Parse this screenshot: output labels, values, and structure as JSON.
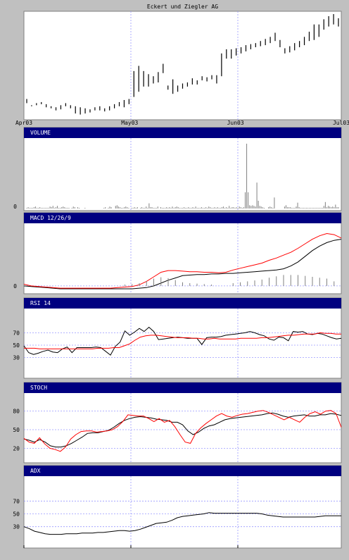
{
  "colors": {
    "background": "#c0c0c0",
    "panel": "#ffffff",
    "header": "#000080",
    "header_text": "#ffffff",
    "grid": "#9999ff",
    "line_black": "#000000",
    "line_red": "#ff0000",
    "volume_bar": "#808080"
  },
  "chart_data": [
    {
      "type": "bar",
      "subtype": "ohlc",
      "title": "Eckert und Ziegler AG",
      "x_tick_labels": [
        "Apr03",
        "May03",
        "Jun03",
        "Jul03"
      ],
      "x_tick_index": [
        0,
        21,
        42,
        63
      ],
      "ylim": [
        0,
        100
      ],
      "grid": "vertical dashed",
      "series": [
        {
          "values": [
            {
              "h": 18,
              "l": 14
            },
            {
              "h": 12,
              "l": 11
            },
            {
              "h": 14,
              "l": 12
            },
            {
              "h": 15,
              "l": 13
            },
            {
              "h": 13,
              "l": 10
            },
            {
              "h": 11,
              "l": 9
            },
            {
              "h": 10,
              "l": 7
            },
            {
              "h": 12,
              "l": 8
            },
            {
              "h": 14,
              "l": 11
            },
            {
              "h": 12,
              "l": 9
            },
            {
              "h": 11,
              "l": 4
            },
            {
              "h": 10,
              "l": 3
            },
            {
              "h": 9,
              "l": 4
            },
            {
              "h": 8,
              "l": 5
            },
            {
              "h": 10,
              "l": 7
            },
            {
              "h": 11,
              "l": 7
            },
            {
              "h": 9,
              "l": 6
            },
            {
              "h": 11,
              "l": 7
            },
            {
              "h": 13,
              "l": 9
            },
            {
              "h": 15,
              "l": 11
            },
            {
              "h": 17,
              "l": 10
            },
            {
              "h": 18,
              "l": 13
            },
            {
              "h": 45,
              "l": 20
            },
            {
              "h": 50,
              "l": 25
            },
            {
              "h": 45,
              "l": 30
            },
            {
              "h": 42,
              "l": 30
            },
            {
              "h": 40,
              "l": 33
            },
            {
              "h": 44,
              "l": 34
            },
            {
              "h": 52,
              "l": 43
            },
            {
              "h": 31,
              "l": 27
            },
            {
              "h": 37,
              "l": 23
            },
            {
              "h": 31,
              "l": 25
            },
            {
              "h": 33,
              "l": 28
            },
            {
              "h": 34,
              "l": 30
            },
            {
              "h": 38,
              "l": 32
            },
            {
              "h": 36,
              "l": 32
            },
            {
              "h": 40,
              "l": 36
            },
            {
              "h": 39,
              "l": 35
            },
            {
              "h": 41,
              "l": 37
            },
            {
              "h": 41,
              "l": 33
            },
            {
              "h": 62,
              "l": 40
            },
            {
              "h": 66,
              "l": 57
            },
            {
              "h": 66,
              "l": 57
            },
            {
              "h": 67,
              "l": 60
            },
            {
              "h": 68,
              "l": 62
            },
            {
              "h": 70,
              "l": 64
            },
            {
              "h": 71,
              "l": 66
            },
            {
              "h": 72,
              "l": 68
            },
            {
              "h": 74,
              "l": 69
            },
            {
              "h": 76,
              "l": 70
            },
            {
              "h": 78,
              "l": 72
            },
            {
              "h": 82,
              "l": 74
            },
            {
              "h": 75,
              "l": 68
            },
            {
              "h": 67,
              "l": 62
            },
            {
              "h": 69,
              "l": 63
            },
            {
              "h": 72,
              "l": 65
            },
            {
              "h": 74,
              "l": 68
            },
            {
              "h": 78,
              "l": 70
            },
            {
              "h": 83,
              "l": 74
            },
            {
              "h": 90,
              "l": 75
            },
            {
              "h": 90,
              "l": 78
            },
            {
              "h": 95,
              "l": 85
            },
            {
              "h": 98,
              "l": 88
            },
            {
              "h": 100,
              "l": 90
            },
            {
              "h": 96,
              "l": 88
            }
          ]
        }
      ]
    },
    {
      "type": "bar",
      "label": "VOLUME",
      "y_tick_labels": [
        "0"
      ],
      "ylim": [
        0,
        100
      ],
      "series": [
        {
          "values": [
            1,
            2,
            1,
            1,
            1,
            2,
            3,
            1,
            1,
            2,
            1,
            1,
            1,
            1,
            1,
            1,
            3,
            2,
            4,
            1,
            2,
            4,
            1,
            1,
            2,
            3,
            2,
            1,
            1,
            1,
            0,
            1,
            3,
            2,
            0,
            2,
            1,
            0,
            0,
            0,
            1,
            0,
            0,
            0,
            0,
            0,
            0,
            0,
            0,
            0,
            0,
            0,
            0,
            1,
            2,
            0,
            1,
            3,
            2,
            0,
            0,
            4,
            5,
            3,
            2,
            1,
            1,
            2,
            3,
            2,
            1,
            0,
            1,
            1,
            2,
            1,
            2,
            0,
            1,
            2,
            1,
            1,
            3,
            1,
            8,
            2,
            2,
            1,
            1,
            1,
            3,
            0,
            2,
            1,
            1,
            1,
            2,
            1,
            2,
            1,
            3,
            1,
            2,
            3,
            2,
            1,
            1,
            1,
            2,
            1,
            1,
            2,
            1,
            1,
            2,
            1,
            3,
            1,
            1,
            1,
            2,
            1,
            1,
            2,
            1,
            3,
            2,
            1,
            1,
            2,
            1,
            2,
            1,
            1,
            2,
            3,
            1,
            2,
            1,
            4,
            1,
            2,
            2,
            1,
            2,
            1,
            3,
            2,
            1,
            2,
            25,
            100,
            25,
            5,
            4,
            5,
            4,
            3,
            40,
            12,
            4,
            3,
            2,
            1,
            0,
            0,
            2,
            3,
            2,
            1,
            17,
            0,
            0,
            0,
            0,
            0,
            0,
            3,
            5,
            2,
            2,
            2,
            1,
            1,
            1,
            3,
            9,
            2,
            1,
            1,
            1,
            1,
            1,
            1,
            1,
            1,
            1,
            1,
            1,
            1,
            1,
            1,
            1,
            1,
            4,
            10,
            2,
            4,
            3,
            2,
            3,
            2,
            6,
            2,
            2
          ]
        }
      ]
    },
    {
      "type": "line",
      "label": "MACD 12/26/9",
      "y_tick_labels": [
        "0"
      ],
      "ylim": [
        -10,
        100
      ],
      "series": [
        {
          "color": "#000000",
          "values": [
            0,
            -1,
            -2,
            -3,
            -4,
            -5,
            -5,
            -5,
            -5,
            -5,
            -5,
            -5,
            -5,
            -5,
            -5,
            -5,
            -4,
            -3,
            0,
            5,
            10,
            14,
            18,
            19,
            20,
            20,
            21,
            21,
            22,
            22,
            23,
            24,
            25,
            26,
            27,
            28,
            30,
            35,
            42,
            52,
            62,
            70,
            76,
            80,
            82
          ]
        },
        {
          "color": "#ff0000",
          "values": [
            3,
            0,
            -1,
            -2,
            -3,
            -4,
            -4,
            -4,
            -4,
            -4,
            -4,
            -4,
            -4,
            -3,
            -2,
            -1,
            2,
            8,
            16,
            24,
            27,
            27,
            26,
            25,
            25,
            24,
            24,
            23,
            24,
            28,
            31,
            34,
            37,
            40,
            45,
            49,
            54,
            59,
            66,
            74,
            82,
            88,
            92,
            90,
            84
          ]
        }
      ]
    },
    {
      "type": "line",
      "label": "RSI 14",
      "y_tick_labels": [
        "70",
        "50",
        "30"
      ],
      "y_ticks": [
        70,
        50,
        30
      ],
      "ylim": [
        0,
        100
      ],
      "series": [
        {
          "color": "#000000",
          "values": [
            49,
            38,
            35,
            37,
            40,
            42,
            39,
            38,
            44,
            47,
            38,
            46,
            46,
            46,
            46,
            47,
            46,
            40,
            34,
            48,
            55,
            73,
            66,
            71,
            77,
            72,
            79,
            72,
            59,
            60,
            61,
            62,
            63,
            62,
            61,
            61,
            61,
            51,
            62,
            63,
            63,
            64,
            66,
            67,
            68,
            69,
            70,
            72,
            70,
            67,
            65,
            60,
            58,
            63,
            62,
            57,
            72,
            71,
            72,
            68,
            67,
            69,
            68,
            65,
            62,
            60,
            61
          ]
        },
        {
          "color": "#ff0000",
          "values": [
            45,
            45,
            45,
            44,
            44,
            44,
            44,
            44,
            44,
            44,
            44,
            44,
            44,
            44,
            45,
            45,
            45,
            46,
            46,
            49,
            52,
            58,
            63,
            65,
            66,
            66,
            65,
            64,
            63,
            62,
            62,
            62,
            61,
            61,
            60,
            60,
            61,
            60,
            60,
            60,
            60,
            61,
            61,
            61,
            61,
            62,
            62,
            63,
            64,
            65,
            66,
            66,
            67,
            68,
            68,
            68,
            70,
            69,
            69,
            68,
            68
          ]
        }
      ]
    },
    {
      "type": "line",
      "label": "STOCH",
      "y_tick_labels": [
        "80",
        "50",
        "20"
      ],
      "y_ticks": [
        80,
        50,
        20
      ],
      "ylim": [
        0,
        100
      ],
      "series": [
        {
          "color": "#000000",
          "values": [
            35,
            33,
            30,
            34,
            30,
            24,
            22,
            22,
            24,
            28,
            33,
            38,
            44,
            45,
            45,
            47,
            49,
            54,
            60,
            65,
            68,
            70,
            71,
            70,
            69,
            67,
            66,
            65,
            62,
            62,
            58,
            48,
            42,
            46,
            52,
            56,
            58,
            62,
            66,
            68,
            69,
            70,
            71,
            72,
            73,
            74,
            76,
            77,
            75,
            72,
            70,
            72,
            73,
            74,
            72,
            72,
            74,
            74,
            76,
            75,
            73
          ]
        },
        {
          "color": "#ff0000",
          "values": [
            36,
            30,
            28,
            37,
            27,
            20,
            18,
            15,
            22,
            35,
            42,
            47,
            48,
            48,
            46,
            47,
            48,
            50,
            55,
            63,
            74,
            73,
            72,
            72,
            68,
            63,
            68,
            62,
            65,
            55,
            42,
            30,
            28,
            44,
            53,
            60,
            66,
            72,
            76,
            72,
            70,
            73,
            75,
            76,
            78,
            80,
            81,
            78,
            74,
            70,
            66,
            70,
            66,
            62,
            70,
            76,
            79,
            75,
            80,
            81,
            76,
            54
          ]
        }
      ]
    },
    {
      "type": "line",
      "label": "ADX",
      "y_tick_labels": [
        "70",
        "50",
        "30"
      ],
      "y_ticks": [
        70,
        50,
        30
      ],
      "ylim": [
        0,
        100
      ],
      "series": [
        {
          "color": "#000000",
          "values": [
            30,
            27,
            23,
            21,
            19,
            18,
            18,
            18,
            19,
            19,
            19,
            20,
            20,
            20,
            21,
            21,
            22,
            23,
            24,
            24,
            23,
            24,
            26,
            29,
            32,
            35,
            36,
            37,
            40,
            44,
            46,
            47,
            48,
            49,
            50,
            52,
            51,
            51,
            51,
            51,
            51,
            51,
            51,
            51,
            51,
            50,
            48,
            47,
            46,
            45,
            45,
            45,
            45,
            45,
            45,
            45,
            46,
            47,
            47,
            47,
            47
          ]
        }
      ]
    }
  ]
}
